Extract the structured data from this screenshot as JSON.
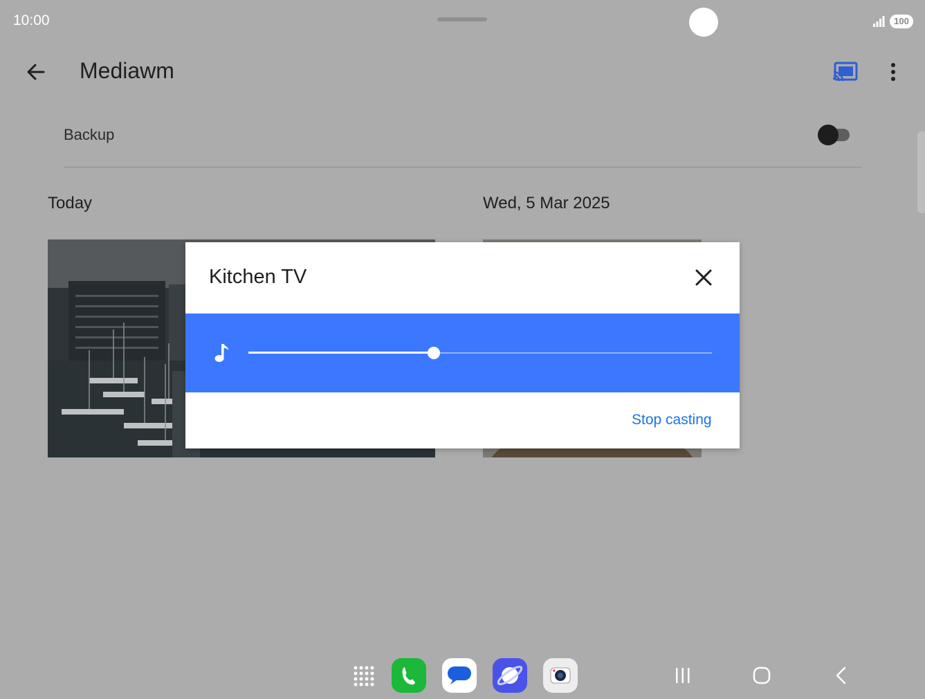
{
  "status_bar": {
    "time": "10:00",
    "battery": "100",
    "icons": [
      "signal-icon",
      "battery-icon"
    ]
  },
  "app_bar": {
    "title": "Mediawm",
    "back_icon": "arrow-back-icon",
    "cast_icon": "cast-connected-icon",
    "more_icon": "more-vert-icon",
    "cast_color": "#2f5fd0"
  },
  "backup": {
    "label": "Backup",
    "enabled": false
  },
  "sections": [
    {
      "date": "Today"
    },
    {
      "date": "Wed, 5 Mar 2025"
    }
  ],
  "cast_dialog": {
    "title": "Kitchen TV",
    "close_icon": "close-icon",
    "volume_icon": "music-note-icon",
    "volume_level": 0.4,
    "stop_label": "Stop casting",
    "accent": "#3b78ff",
    "link_color": "#1a73e8"
  },
  "dock": {
    "apps": [
      "apps-grid-icon",
      "phone-app-icon",
      "messages-app-icon",
      "internet-app-icon",
      "camera-app-icon"
    ],
    "nav": [
      "recents-icon",
      "home-icon",
      "back-nav-icon"
    ]
  }
}
